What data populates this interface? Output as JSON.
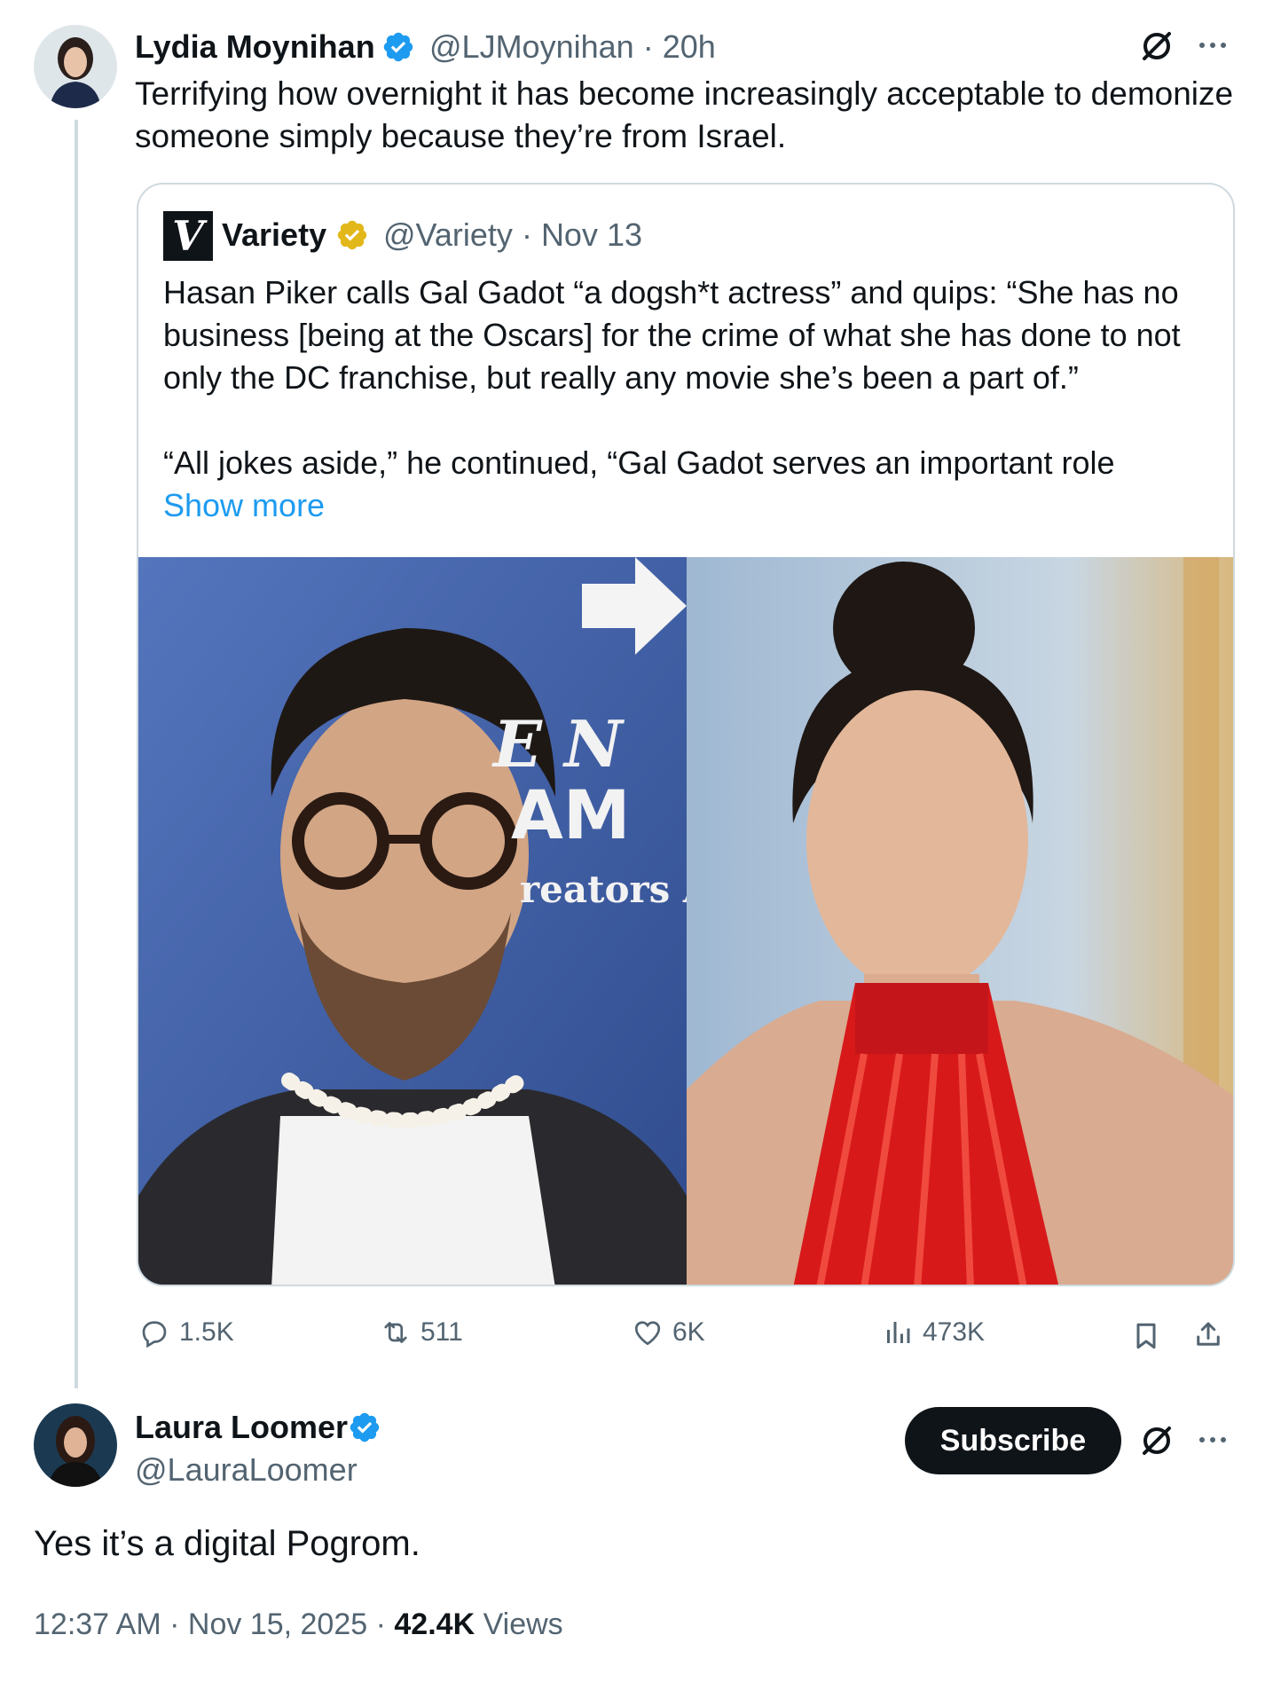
{
  "parent_tweet": {
    "author_name": "Lydia Moynihan",
    "handle": "@LJMoynihan",
    "time": "20h",
    "text": "Terrifying how overnight it has become increasingly acceptable to demonize someone simply because they’re from Israel.",
    "quoted": {
      "logo_letter": "V",
      "author_name": "Variety",
      "handle": "@Variety",
      "date": "Nov 13",
      "paragraph1": "Hasan Piker calls Gal Gadot “a dogsh*t actress” and quips: “She has no business [being at the Oscars] for the crime of what she has done to not only the DC franchise, but really any movie she’s been a part of.”",
      "paragraph2": "“All jokes aside,” he continued, “Gal Gadot serves an important role",
      "show_more": "Show more",
      "backdrop_text_1": "E N",
      "backdrop_text_2": "AM",
      "backdrop_text_3": "reators A"
    },
    "stats": {
      "replies": "1.5K",
      "reposts": "511",
      "likes": "6K",
      "views": "473K"
    }
  },
  "main_tweet": {
    "author_name": "Laura Loomer",
    "handle": "@LauraLoomer",
    "subscribe_label": "Subscribe",
    "text": "Yes it’s a digital Pogrom.",
    "time": "12:37 AM",
    "date": "Nov 15, 2025",
    "views_count": "42.4K",
    "views_label": "Views"
  },
  "colors": {
    "verified_blue": "#1d9bf0",
    "verified_gold": "#e2b719",
    "muted_text": "#536471",
    "text": "#0f1419"
  }
}
